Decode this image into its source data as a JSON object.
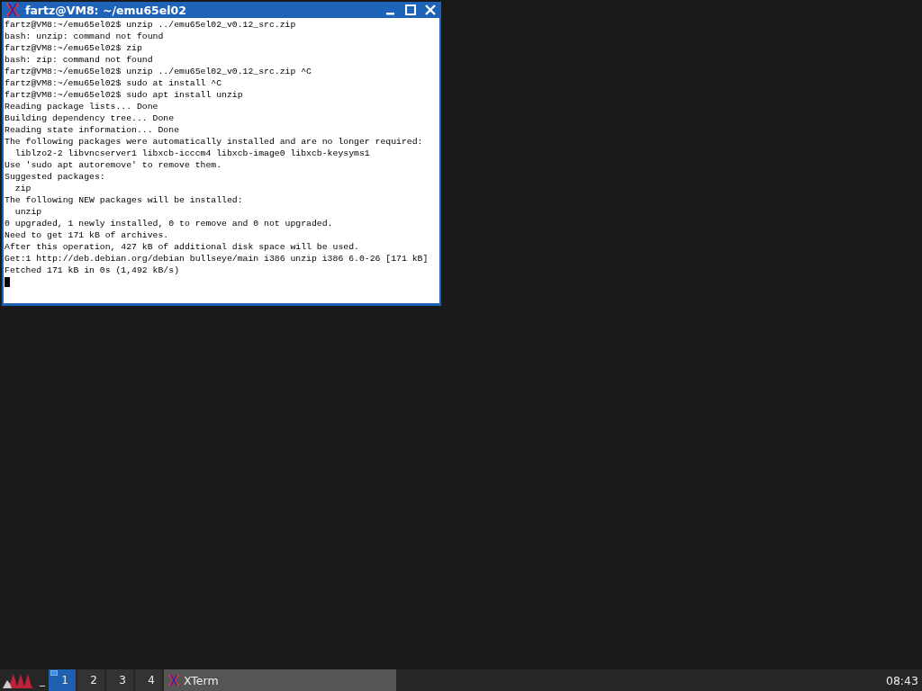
{
  "window": {
    "title": "fartz@VM8: ~/emu65el02",
    "lines": [
      "fartz@VM8:~/emu65el02$ unzip ../emu65el02_v0.12_src.zip",
      "bash: unzip: command not found",
      "fartz@VM8:~/emu65el02$ zip",
      "bash: zip: command not found",
      "fartz@VM8:~/emu65el02$ unzip ../emu65el02_v0.12_src.zip ^C",
      "fartz@VM8:~/emu65el02$ sudo at install ^C",
      "fartz@VM8:~/emu65el02$ sudo apt install unzip",
      "Reading package lists... Done",
      "Building dependency tree... Done",
      "Reading state information... Done",
      "The following packages were automatically installed and are no longer required:",
      "  liblzo2-2 libvncserver1 libxcb-icccm4 libxcb-image0 libxcb-keysyms1",
      "Use 'sudo apt autoremove' to remove them.",
      "Suggested packages:",
      "  zip",
      "The following NEW packages will be installed:",
      "  unzip",
      "0 upgraded, 1 newly installed, 0 to remove and 0 not upgraded.",
      "Need to get 171 kB of archives.",
      "After this operation, 427 kB of additional disk space will be used.",
      "Get:1 http://deb.debian.org/debian bullseye/main i386 unzip i386 6.0-26 [171 kB]",
      "Fetched 171 kB in 0s (1,492 kB/s)"
    ]
  },
  "taskbar": {
    "show_desktop": "_",
    "workspaces": [
      {
        "label": "1",
        "selected": true
      },
      {
        "label": "2",
        "selected": false
      },
      {
        "label": "3",
        "selected": false
      },
      {
        "label": "4",
        "selected": false
      }
    ],
    "tasks": [
      {
        "label": "XTerm"
      }
    ],
    "clock": "08:43"
  }
}
